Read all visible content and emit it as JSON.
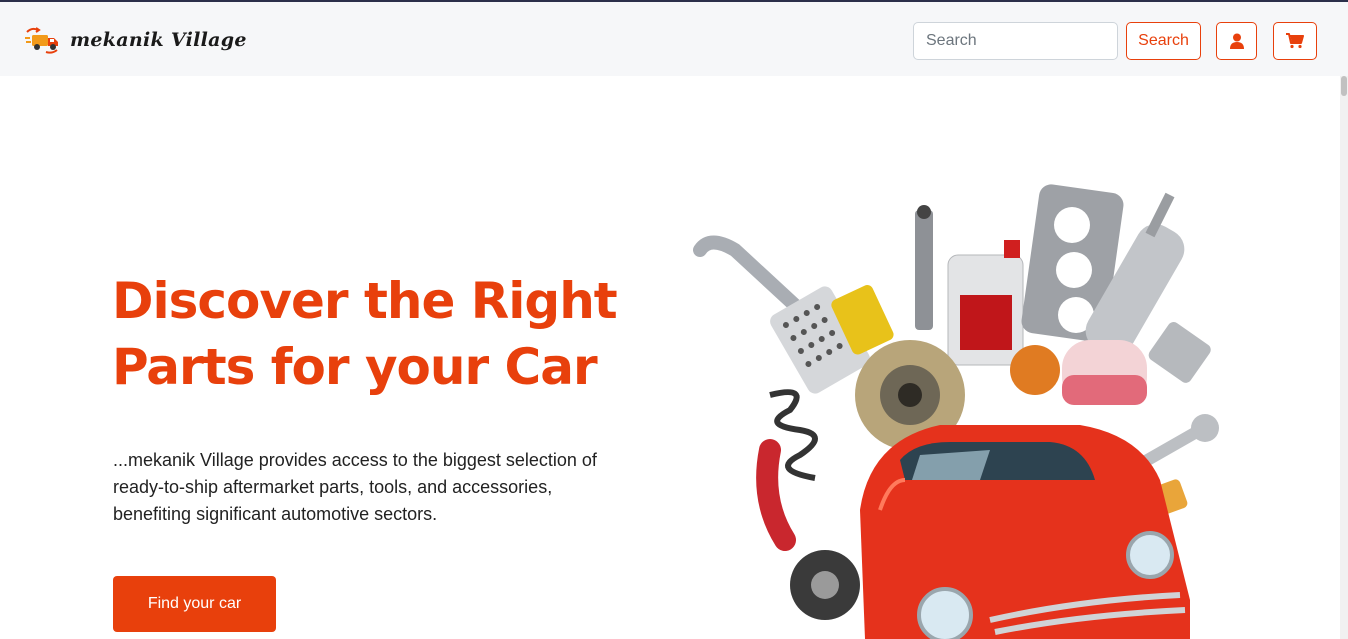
{
  "brand": {
    "name": "mekanik Village",
    "logo_icon": "delivery-truck-icon"
  },
  "header": {
    "search_placeholder": "Search",
    "search_value": "",
    "search_button": "Search",
    "user_icon": "user-icon",
    "cart_icon": "cart-icon"
  },
  "hero": {
    "title": "Discover the Right Parts for your Car",
    "description": "...mekanik Village provides access to the biggest selection of ready-to-ship aftermarket parts, tools, and accessories, benefiting significant automotive sectors.",
    "cta_label": "Find your car",
    "illustration": "car-parts-illustration"
  },
  "colors": {
    "accent": "#e8400c",
    "navbar_bg": "#f6f7f9",
    "text": "#222222"
  }
}
